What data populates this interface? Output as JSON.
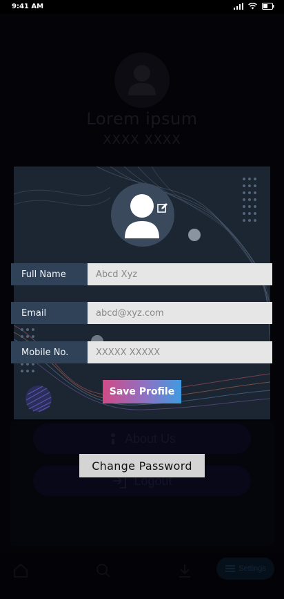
{
  "status_bar": {
    "time": "9:41 AM"
  },
  "profile_background": {
    "name": "Lorem ipsum",
    "subtitle": "XXXX XXXX",
    "menu": {
      "about": "About Us",
      "logout": "Logout"
    },
    "bottom_nav": {
      "settings_label": "Settings"
    }
  },
  "modal": {
    "fields": [
      {
        "label": "Full Name",
        "placeholder": "Abcd Xyz"
      },
      {
        "label": "Email",
        "placeholder": "abcd@xyz.com"
      },
      {
        "label": "Mobile No.",
        "placeholder": "XXXXX XXXXX"
      }
    ],
    "save_label": "Save Profile"
  },
  "change_password_label": "Change Password",
  "colors": {
    "modal_bg": "#1c2532",
    "label_bg": "#2f4258",
    "save_gradient_start": "#d14a86",
    "save_gradient_end": "#3f9be0"
  }
}
